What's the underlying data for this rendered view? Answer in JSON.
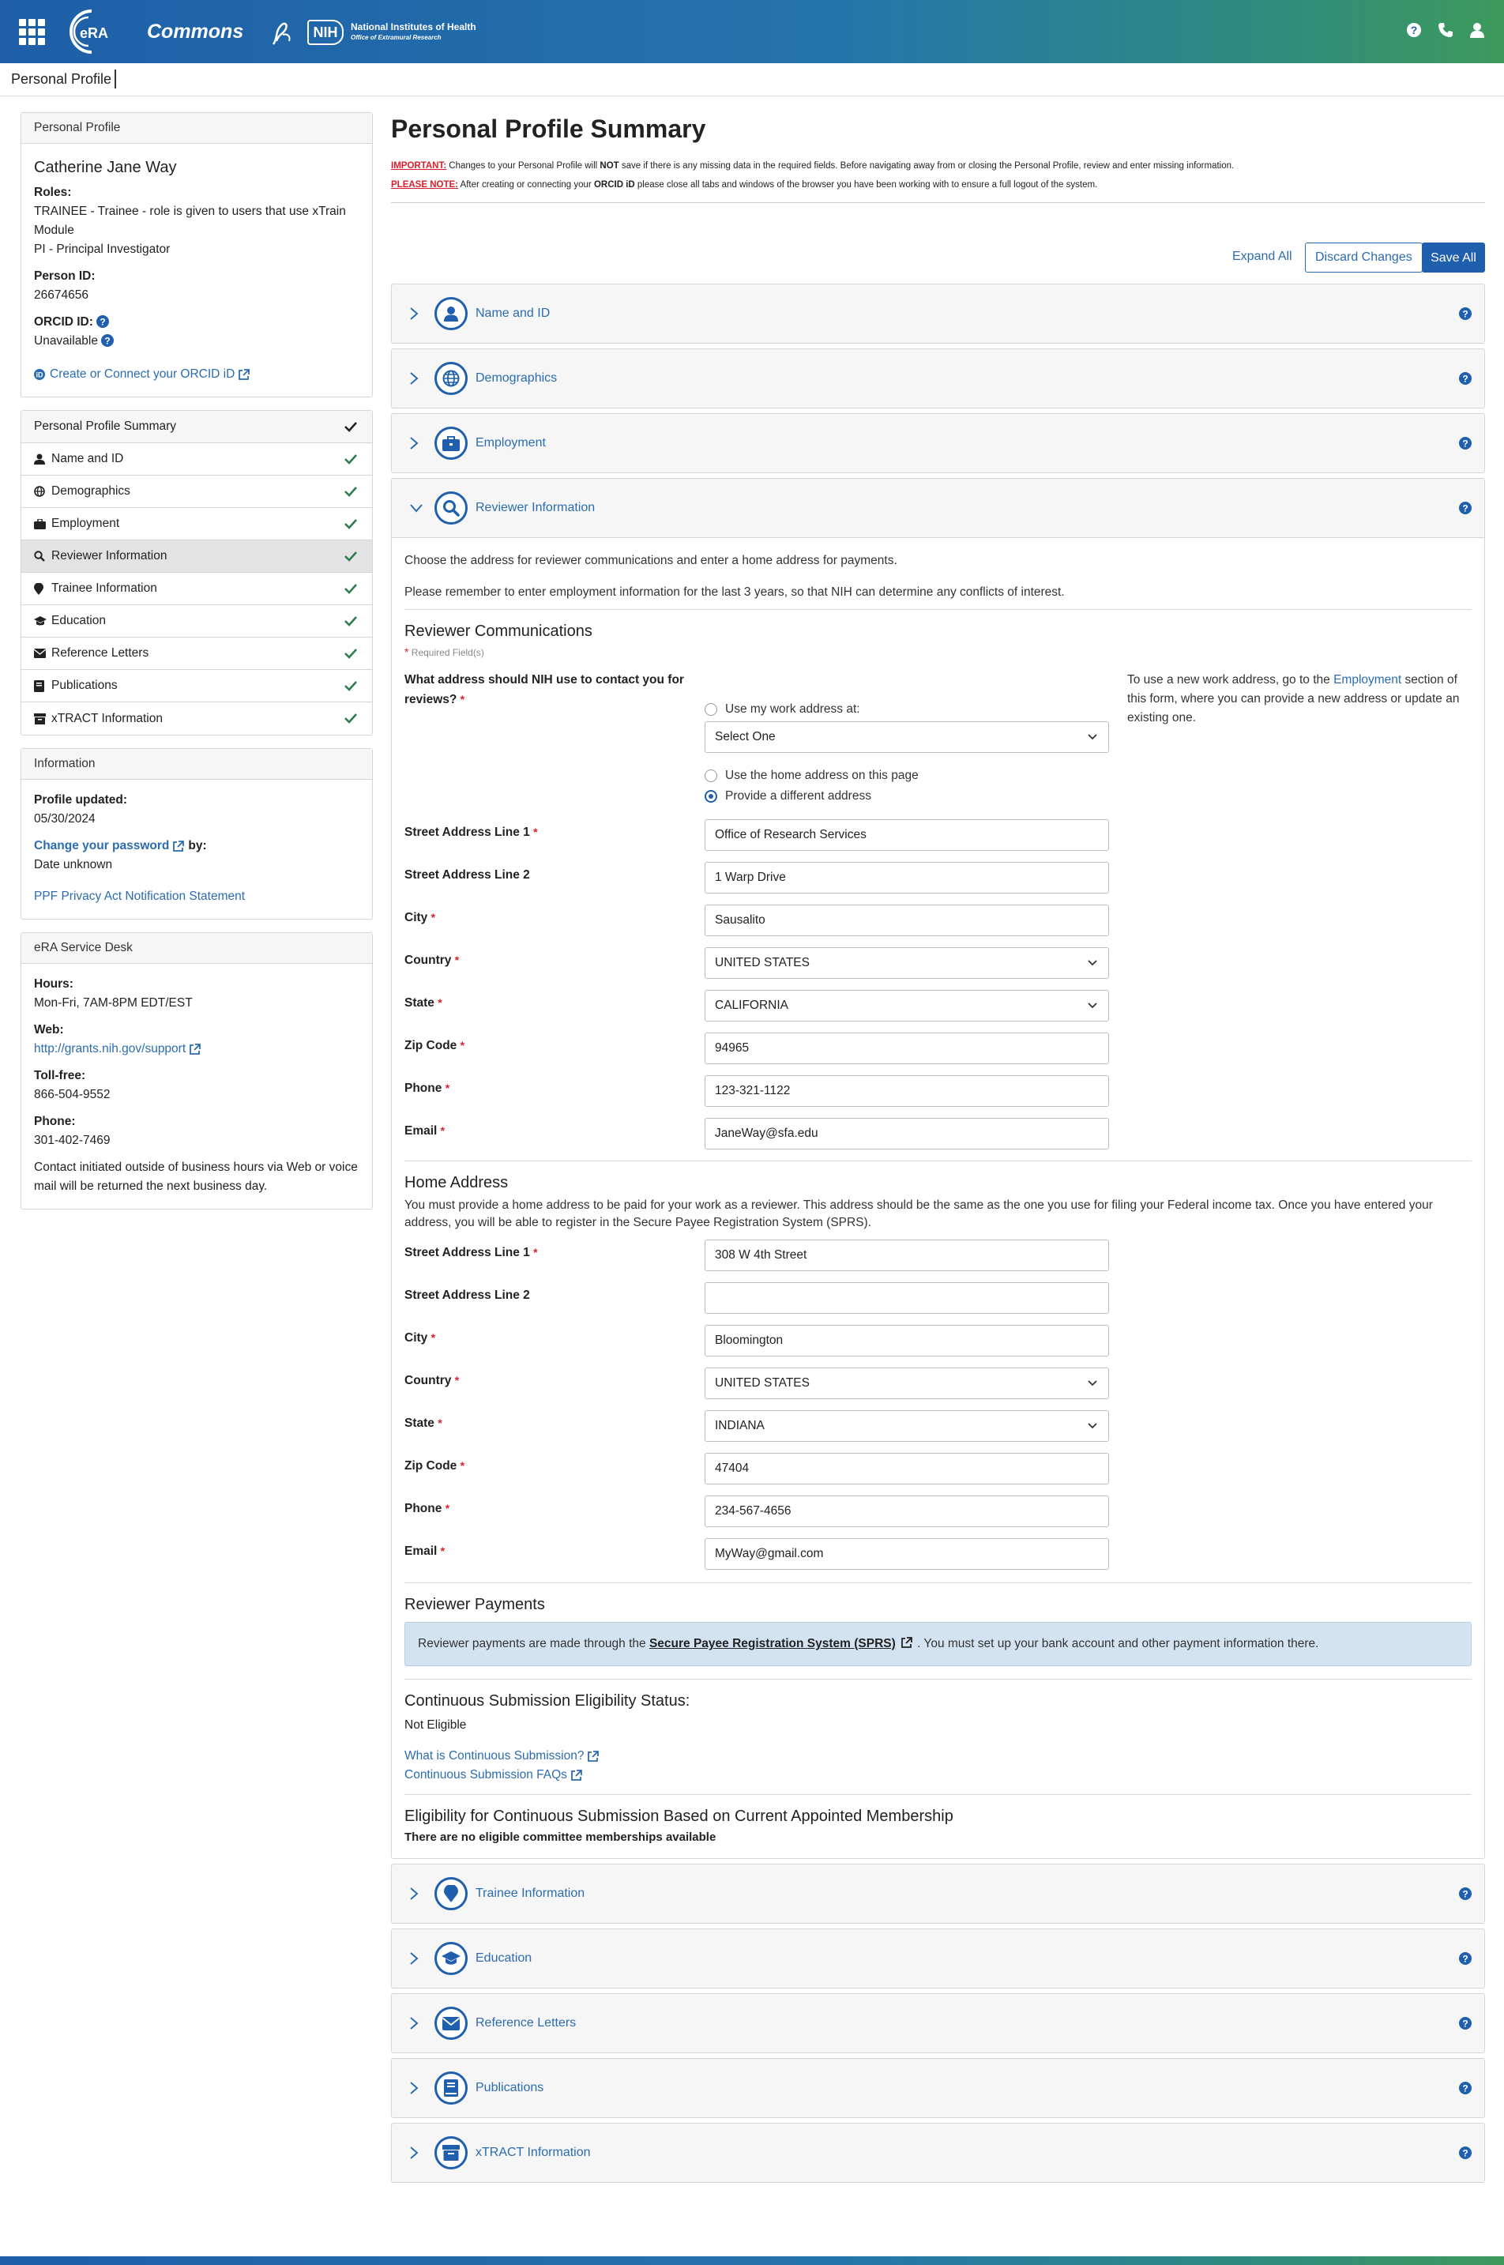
{
  "header": {
    "logo_text": "eRA",
    "app_name": "Commons",
    "nih_abbrev": "NIH",
    "nih_name": "National Institutes of Health",
    "nih_sub": "Office of Extramural Research",
    "icons": [
      "help-icon",
      "phone-icon",
      "user-icon"
    ]
  },
  "breadcrumb": {
    "label": "Personal Profile"
  },
  "profile_card": {
    "title": "Personal Profile",
    "name": "Catherine Jane Way",
    "roles_label": "Roles:",
    "role_1": "TRAINEE - Trainee - role is given to users that use xTrain Module",
    "role_2": "PI - Principal Investigator",
    "person_id_label": "Person ID:",
    "person_id": "26674656",
    "orcid_label": "ORCID ID:",
    "orcid_value": "Unavailable",
    "orcid_link": "Create or Connect your ORCID iD"
  },
  "nav": {
    "header": "Personal Profile Summary",
    "items": [
      {
        "label": "Name and ID",
        "icon": "user-icon"
      },
      {
        "label": "Demographics",
        "icon": "globe-icon"
      },
      {
        "label": "Employment",
        "icon": "briefcase-icon"
      },
      {
        "label": "Reviewer Information",
        "icon": "search-icon"
      },
      {
        "label": "Trainee Information",
        "icon": "map-pin-icon"
      },
      {
        "label": "Education",
        "icon": "graduation-cap-icon"
      },
      {
        "label": "Reference Letters",
        "icon": "envelope-icon"
      },
      {
        "label": "Publications",
        "icon": "book-icon"
      },
      {
        "label": "xTRACT Information",
        "icon": "archive-icon"
      }
    ]
  },
  "info_card": {
    "title": "Information",
    "updated_label": "Profile updated:",
    "updated_value": "05/30/2024",
    "password_link": "Change your password",
    "by_label": "by:",
    "by_value": "Date unknown",
    "privacy_link": "PPF Privacy Act Notification Statement"
  },
  "desk_card": {
    "title": "eRA Service Desk",
    "hours_label": "Hours:",
    "hours_value": "Mon-Fri, 7AM-8PM EDT/EST",
    "web_label": "Web:",
    "web_link": "http://grants.nih.gov/support",
    "tollfree_label": "Toll-free:",
    "tollfree_value": "866-504-9552",
    "phone_label": "Phone:",
    "phone_value": "301-402-7469",
    "note": "Contact initiated outside of business hours via Web or voice mail will be returned the next business day."
  },
  "main": {
    "title": "Personal Profile Summary",
    "important_label": "IMPORTANT:",
    "important_text_1": " Changes to your Personal Profile will ",
    "important_not": "NOT",
    "important_text_2": " save if there is any missing data in the required fields. Before navigating away from or closing the Personal Profile, review and enter missing information.",
    "please_label": "PLEASE NOTE:",
    "please_text_1": " After creating or connecting your ",
    "please_orcid": "ORCID iD",
    "please_text_2": " please close all tabs and windows of the browser you have been working with to ensure a full logout of the system.",
    "expand_all": "Expand All",
    "discard": "Discard Changes",
    "save_all": "Save All"
  },
  "sections_top": [
    {
      "title": "Name and ID",
      "icon": "user-icon"
    },
    {
      "title": "Demographics",
      "icon": "globe-icon"
    },
    {
      "title": "Employment",
      "icon": "briefcase-icon"
    }
  ],
  "reviewer": {
    "title": "Reviewer Information",
    "intro_1": "Choose the address for reviewer communications and enter a home address for payments.",
    "intro_2": "Please remember to enter employment information for the last 3 years, so that NIH can determine any conflicts of interest.",
    "comm_heading": "Reviewer Communications",
    "required_note": "Required Field(s)",
    "contact_question": "What address should NIH use to contact you for reviews?",
    "option_work": "Use my work address at:",
    "select_placeholder": "Select One",
    "option_home": "Use the home address on this page",
    "option_diff": "Provide a different address",
    "selected_option": "option_diff",
    "side_note_1": "To use a new work address, go to the ",
    "side_note_link": "Employment",
    "side_note_2": " section of this form, where you can provide a new address or update an existing one.",
    "comm_fields": [
      {
        "label": "Street Address Line 1",
        "required": true,
        "value": "Office of Research Services",
        "type": "text"
      },
      {
        "label": "Street Address Line 2",
        "required": false,
        "value": "1 Warp Drive",
        "type": "text"
      },
      {
        "label": "City",
        "required": true,
        "value": "Sausalito",
        "type": "text"
      },
      {
        "label": "Country",
        "required": true,
        "value": "UNITED STATES",
        "type": "select"
      },
      {
        "label": "State",
        "required": true,
        "value": "CALIFORNIA",
        "type": "select"
      },
      {
        "label": "Zip Code",
        "required": true,
        "value": "94965",
        "type": "text"
      },
      {
        "label": "Phone",
        "required": true,
        "value": "123-321-1122",
        "type": "text"
      },
      {
        "label": "Email",
        "required": true,
        "value": "JaneWay@sfa.edu",
        "type": "text"
      }
    ],
    "home_heading": "Home Address",
    "home_intro": "You must provide a home address to be paid for your work as a reviewer. This address should be the same as the one you use for filing your Federal income tax. Once you have entered your address, you will be able to register in the Secure Payee Registration System (SPRS).",
    "home_fields": [
      {
        "label": "Street Address Line 1",
        "required": true,
        "value": "308 W 4th Street",
        "type": "text"
      },
      {
        "label": "Street Address Line 2",
        "required": false,
        "value": "",
        "type": "text"
      },
      {
        "label": "City",
        "required": true,
        "value": "Bloomington",
        "type": "text"
      },
      {
        "label": "Country",
        "required": true,
        "value": "UNITED STATES",
        "type": "select"
      },
      {
        "label": "State",
        "required": true,
        "value": "INDIANA",
        "type": "select"
      },
      {
        "label": "Zip Code",
        "required": true,
        "value": "47404",
        "type": "text"
      },
      {
        "label": "Phone",
        "required": true,
        "value": "234-567-4656",
        "type": "text"
      },
      {
        "label": "Email",
        "required": true,
        "value": "MyWay@gmail.com",
        "type": "text"
      }
    ],
    "payments_heading": "Reviewer Payments",
    "payments_text_1": "Reviewer payments are made through the ",
    "payments_link": "Secure Payee Registration System (SPRS)",
    "payments_text_2": " . You must set up your bank account and other payment information there.",
    "cs_heading": "Continuous Submission Eligibility Status:",
    "cs_status": "Not Eligible",
    "cs_link_1": "What is Continuous Submission?",
    "cs_link_2": "Continuous Submission FAQs",
    "elig_heading": "Eligibility for Continuous Submission Based on Current Appointed Membership",
    "elig_text": "There are no eligible committee memberships available"
  },
  "sections_bottom": [
    {
      "title": "Trainee Information",
      "icon": "map-pin-icon"
    },
    {
      "title": "Education",
      "icon": "graduation-cap-icon"
    },
    {
      "title": "Reference Letters",
      "icon": "envelope-icon"
    },
    {
      "title": "Publications",
      "icon": "book-icon"
    },
    {
      "title": "xTRACT Information",
      "icon": "archive-icon"
    }
  ],
  "colors": {
    "primary": "#1f5fae",
    "link": "#2b6cb0",
    "required": "#d9202c",
    "check": "#2e7d4f",
    "info_bg": "#d4e3f2"
  }
}
